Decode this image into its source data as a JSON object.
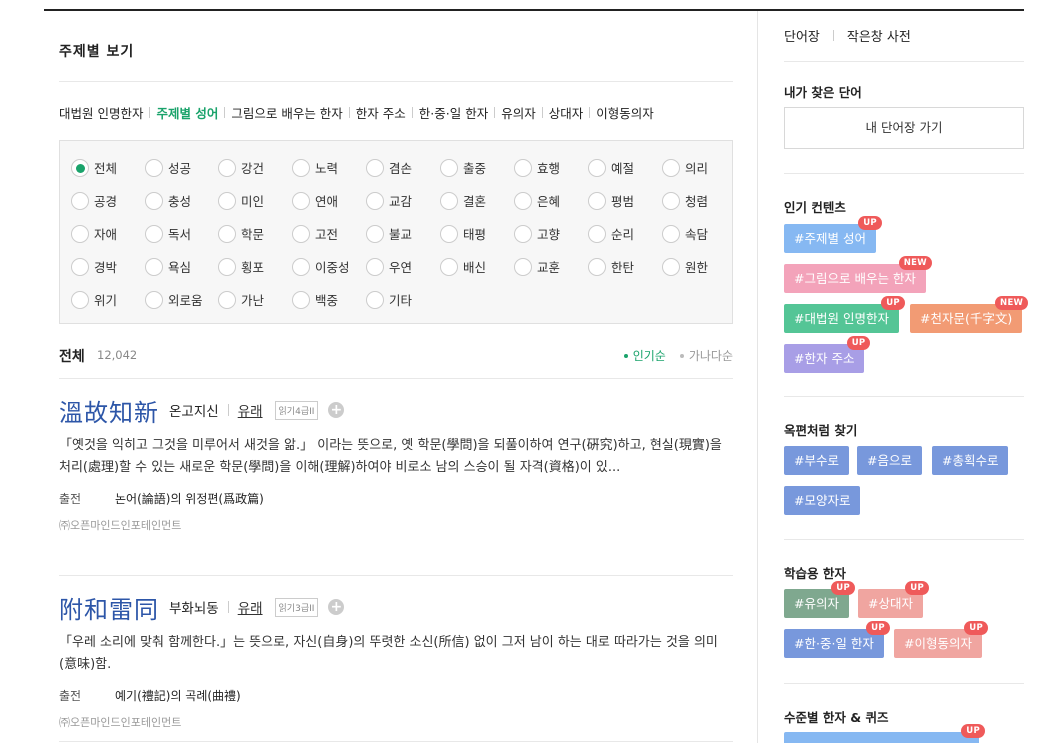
{
  "page_title": "주제별 보기",
  "subnav": [
    {
      "label": "대법원 인명한자",
      "active": false
    },
    {
      "label": "주제별 성어",
      "active": true
    },
    {
      "label": "그림으로 배우는 한자",
      "active": false
    },
    {
      "label": "한자 주소",
      "active": false
    },
    {
      "label": "한·중·일 한자",
      "active": false
    },
    {
      "label": "유의자",
      "active": false
    },
    {
      "label": "상대자",
      "active": false
    },
    {
      "label": "이형동의자",
      "active": false
    }
  ],
  "topics": [
    [
      "전체",
      "성공",
      "강건",
      "노력",
      "겸손",
      "출중",
      "효행",
      "예절",
      "의리"
    ],
    [
      "공경",
      "충성",
      "미인",
      "연애",
      "교감",
      "결혼",
      "은혜",
      "평범",
      "청렴"
    ],
    [
      "자애",
      "독서",
      "학문",
      "고전",
      "불교",
      "태평",
      "고향",
      "순리",
      "속담"
    ],
    [
      "경박",
      "욕심",
      "횡포",
      "이중성",
      "우연",
      "배신",
      "교훈",
      "한탄",
      "원한"
    ],
    [
      "위기",
      "외로움",
      "가난",
      "백중",
      "기타"
    ]
  ],
  "selected_topic": "전체",
  "list": {
    "title": "전체",
    "count": "12,042"
  },
  "sort": {
    "popular": "인기순",
    "alpha": "가나다순"
  },
  "entries": [
    {
      "hanja": "溫故知新",
      "reading": "온고지신",
      "origin_label": "유래",
      "grade": "읽기4급II",
      "meaning": "「옛것을 익히고 그것을 미루어서 새것을 앎.」 이라는 뜻으로, 옛 학문(學問)을 되풀이하여 연구(硏究)하고, 현실(現實)을 처리(處理)할 수 있는 새로운 학문(學問)을 이해(理解)하여야 비로소 남의 스승이 될 자격(資格)이 있...",
      "source_label": "출전",
      "source": "논어(論語)의 위정편(爲政篇)",
      "copyright": "㈜오픈마인드인포테인먼트"
    },
    {
      "hanja": "附和雷同",
      "reading": "부화뇌동",
      "origin_label": "유래",
      "grade": "읽기3급II",
      "meaning": "「우레 소리에 맞춰 함께한다.」는 뜻으로, 자신(自身)의 뚜렷한 소신(所信) 없이 그저 남이 하는 대로 따라가는 것을 의미(意味)함.",
      "source_label": "출전",
      "source": "예기(禮記)의 곡례(曲禮)",
      "copyright": "㈜오픈마인드인포테인먼트"
    }
  ],
  "sidebar": {
    "links": [
      "단어장",
      "작은창 사전"
    ],
    "my_words": {
      "title": "내가 찾은 단어",
      "button": "내 단어장 가기"
    },
    "popular": {
      "title": "인기 컨텐츠",
      "tags": [
        {
          "label": "#주제별 성어",
          "badge": "UP",
          "color": "#86b8f2"
        },
        {
          "label": "#그림으로 배우는 한자",
          "badge": "NEW",
          "color": "#f3a3ba"
        },
        {
          "label": "#대법원 인명한자",
          "badge": "UP",
          "color": "#54c596"
        },
        {
          "label": "#천자문(千字文)",
          "badge": "NEW",
          "color": "#f29b74"
        },
        {
          "label": "#한자 주소",
          "badge": "UP",
          "color": "#a89ee6"
        }
      ]
    },
    "radical": {
      "title": "옥편처럼 찾기",
      "tags": [
        {
          "label": "#부수로",
          "color": "#7898dc"
        },
        {
          "label": "#음으로",
          "color": "#7898dc"
        },
        {
          "label": "#총획수로",
          "color": "#7898dc"
        },
        {
          "label": "#모양자로",
          "color": "#7898dc"
        }
      ]
    },
    "study": {
      "title": "학습용 한자",
      "tags": [
        {
          "label": "#유의자",
          "badge": "UP",
          "color": "#7fa88f"
        },
        {
          "label": "#상대자",
          "badge": "UP",
          "color": "#f0a5a0"
        },
        {
          "label": "#한·중·일 한자",
          "badge": "UP",
          "color": "#7898dc"
        },
        {
          "label": "#이형동의자",
          "badge": "UP",
          "color": "#f0a5a0"
        }
      ]
    },
    "quiz": {
      "title": "수준별 한자 & 퀴즈",
      "badge": "UP",
      "color": "#86b8f2"
    }
  }
}
